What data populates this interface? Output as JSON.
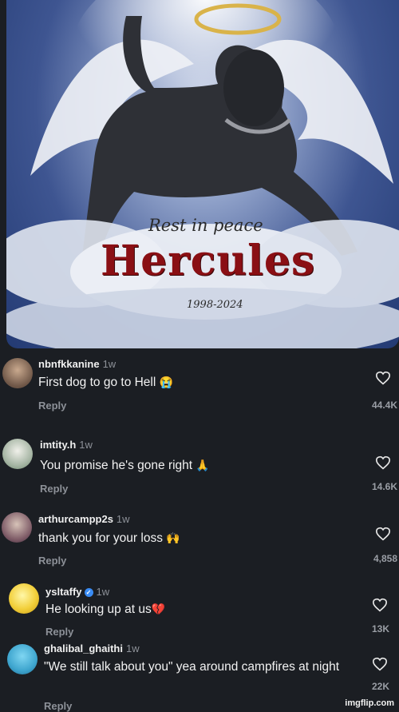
{
  "post_image": {
    "overlay_line1": "Rest in peace",
    "overlay_name": "Hercules",
    "overlay_years": "1998-2024"
  },
  "comments": [
    {
      "username": "nbnfkkanine",
      "time": "1w",
      "text": "First dog to go to Hell",
      "emoji": "😭",
      "reply_label": "Reply",
      "likes": "44.4K",
      "verified": false
    },
    {
      "username": "imtity.h",
      "time": "1w",
      "text": "You promise he's gone right",
      "emoji": "🙏",
      "reply_label": "Reply",
      "likes": "14.6K",
      "verified": false
    },
    {
      "username": "arthurcampp2s",
      "time": "1w",
      "text": "thank you for your loss",
      "emoji": "🙌",
      "reply_label": "Reply",
      "likes": "4,858",
      "verified": false
    },
    {
      "username": "ysltaffy",
      "time": "1w",
      "text": "He looking up at us",
      "emoji": "💔",
      "reply_label": "Reply",
      "likes": "13K",
      "verified": true
    },
    {
      "username": "ghalibal_ghaithi",
      "time": "1w",
      "text": "\"We still talk about you\" yea around campfires at night",
      "emoji": "",
      "reply_label": "Reply",
      "likes": "22K",
      "verified": false
    }
  ],
  "watermark": "imgflip.com",
  "icons": {
    "like": "heart-outline-icon",
    "verified": "verified-badge-icon"
  },
  "colors": {
    "background": "#1b1e23",
    "text": "#f2f2f2",
    "muted": "#8d9198",
    "name_red": "#8a0f14"
  }
}
